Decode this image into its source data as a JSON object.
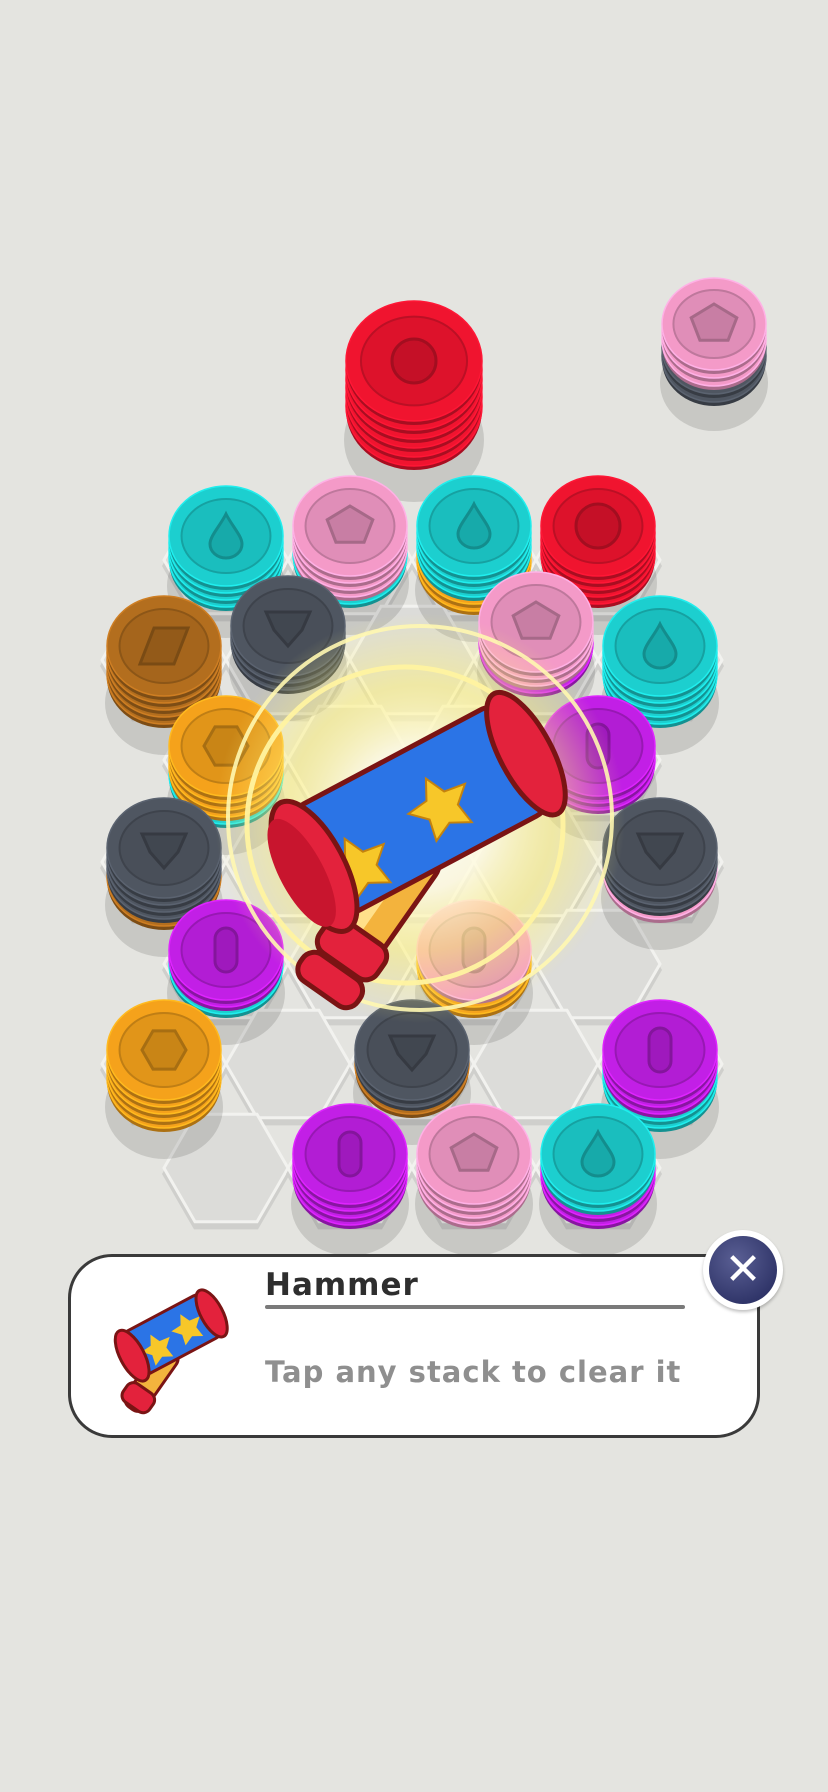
{
  "colors": {
    "background": "#e4e4e0",
    "red": "#f0142f",
    "pink": "#f49ac8",
    "teal": "#1ccfcf",
    "brown": "#b36e1e",
    "gray": "#4f5661",
    "orange": "#f5a21b",
    "purple": "#c21fe6"
  },
  "tray": [
    {
      "layers": [
        "red",
        "red",
        "red",
        "red",
        "red",
        "red"
      ],
      "icon": "circle-icon"
    },
    {
      "layers": [
        "gray",
        "gray",
        "pink",
        "pink",
        "pink"
      ],
      "icon": "pentagon-icon"
    }
  ],
  "board": [
    {
      "layers": [
        "teal",
        "teal",
        "teal",
        "teal"
      ],
      "icon": "drop-icon"
    },
    {
      "layers": [
        "teal",
        "pink",
        "pink",
        "pink",
        "pink"
      ],
      "icon": "pentagon-icon"
    },
    {
      "layers": [
        "orange",
        "orange",
        "teal",
        "teal",
        "teal",
        "teal"
      ],
      "icon": "drop-icon"
    },
    {
      "layers": [
        "red",
        "red",
        "red",
        "red",
        "red"
      ],
      "icon": "circle-icon"
    },
    {
      "layers": [
        "brown",
        "brown",
        "brown",
        "brown",
        "brown"
      ],
      "icon": "diamond-icon"
    },
    {
      "layers": [
        "gray",
        "gray",
        "gray"
      ],
      "icon": "shield-icon"
    },
    {
      "layers": [
        "purple",
        "pink",
        "pink",
        "pink"
      ],
      "icon": "pentagon-icon"
    },
    {
      "layers": [
        "teal",
        "teal",
        "teal",
        "teal",
        "teal"
      ],
      "icon": "drop-icon"
    },
    {
      "layers": [
        "teal",
        "orange",
        "orange",
        "orange",
        "orange"
      ],
      "icon": "hexagon-icon"
    },
    {
      "layers": [
        "purple",
        "purple",
        "purple"
      ],
      "icon": "oval-icon"
    },
    {
      "layers": [
        "brown",
        "gray",
        "gray",
        "gray",
        "gray"
      ],
      "icon": "shield-icon"
    },
    {
      "layers": [
        "pink",
        "gray",
        "gray",
        "gray"
      ],
      "icon": "shield-icon"
    },
    {
      "layers": [
        "teal",
        "purple",
        "purple"
      ],
      "icon": "oval-icon"
    },
    {
      "layers": [
        "orange",
        "orange",
        "pink"
      ],
      "icon": "oval-icon"
    },
    {
      "layers": [
        "orange",
        "orange",
        "orange",
        "orange",
        "orange"
      ],
      "icon": "hexagon-icon"
    },
    {
      "layers": [
        "brown",
        "gray",
        "gray"
      ],
      "icon": "shield-icon"
    },
    {
      "layers": [
        "teal",
        "teal",
        "purple",
        "purple",
        "purple"
      ],
      "icon": "oval-icon"
    },
    {
      "layers": [
        "purple",
        "purple",
        "purple",
        "purple"
      ],
      "icon": "oval-icon"
    },
    {
      "layers": [
        "pink",
        "pink",
        "pink",
        "pink"
      ],
      "icon": "pentagon-icon"
    },
    {
      "layers": [
        "purple",
        "purple",
        "teal",
        "teal"
      ],
      "icon": "drop-icon"
    }
  ],
  "selected_booster": {
    "name": "Hammer",
    "icon": "hammer-icon"
  },
  "tooltip": {
    "title": "Hammer",
    "description": "Tap any stack to clear it",
    "icon": "hammer-icon",
    "close_icon": "close-icon"
  }
}
